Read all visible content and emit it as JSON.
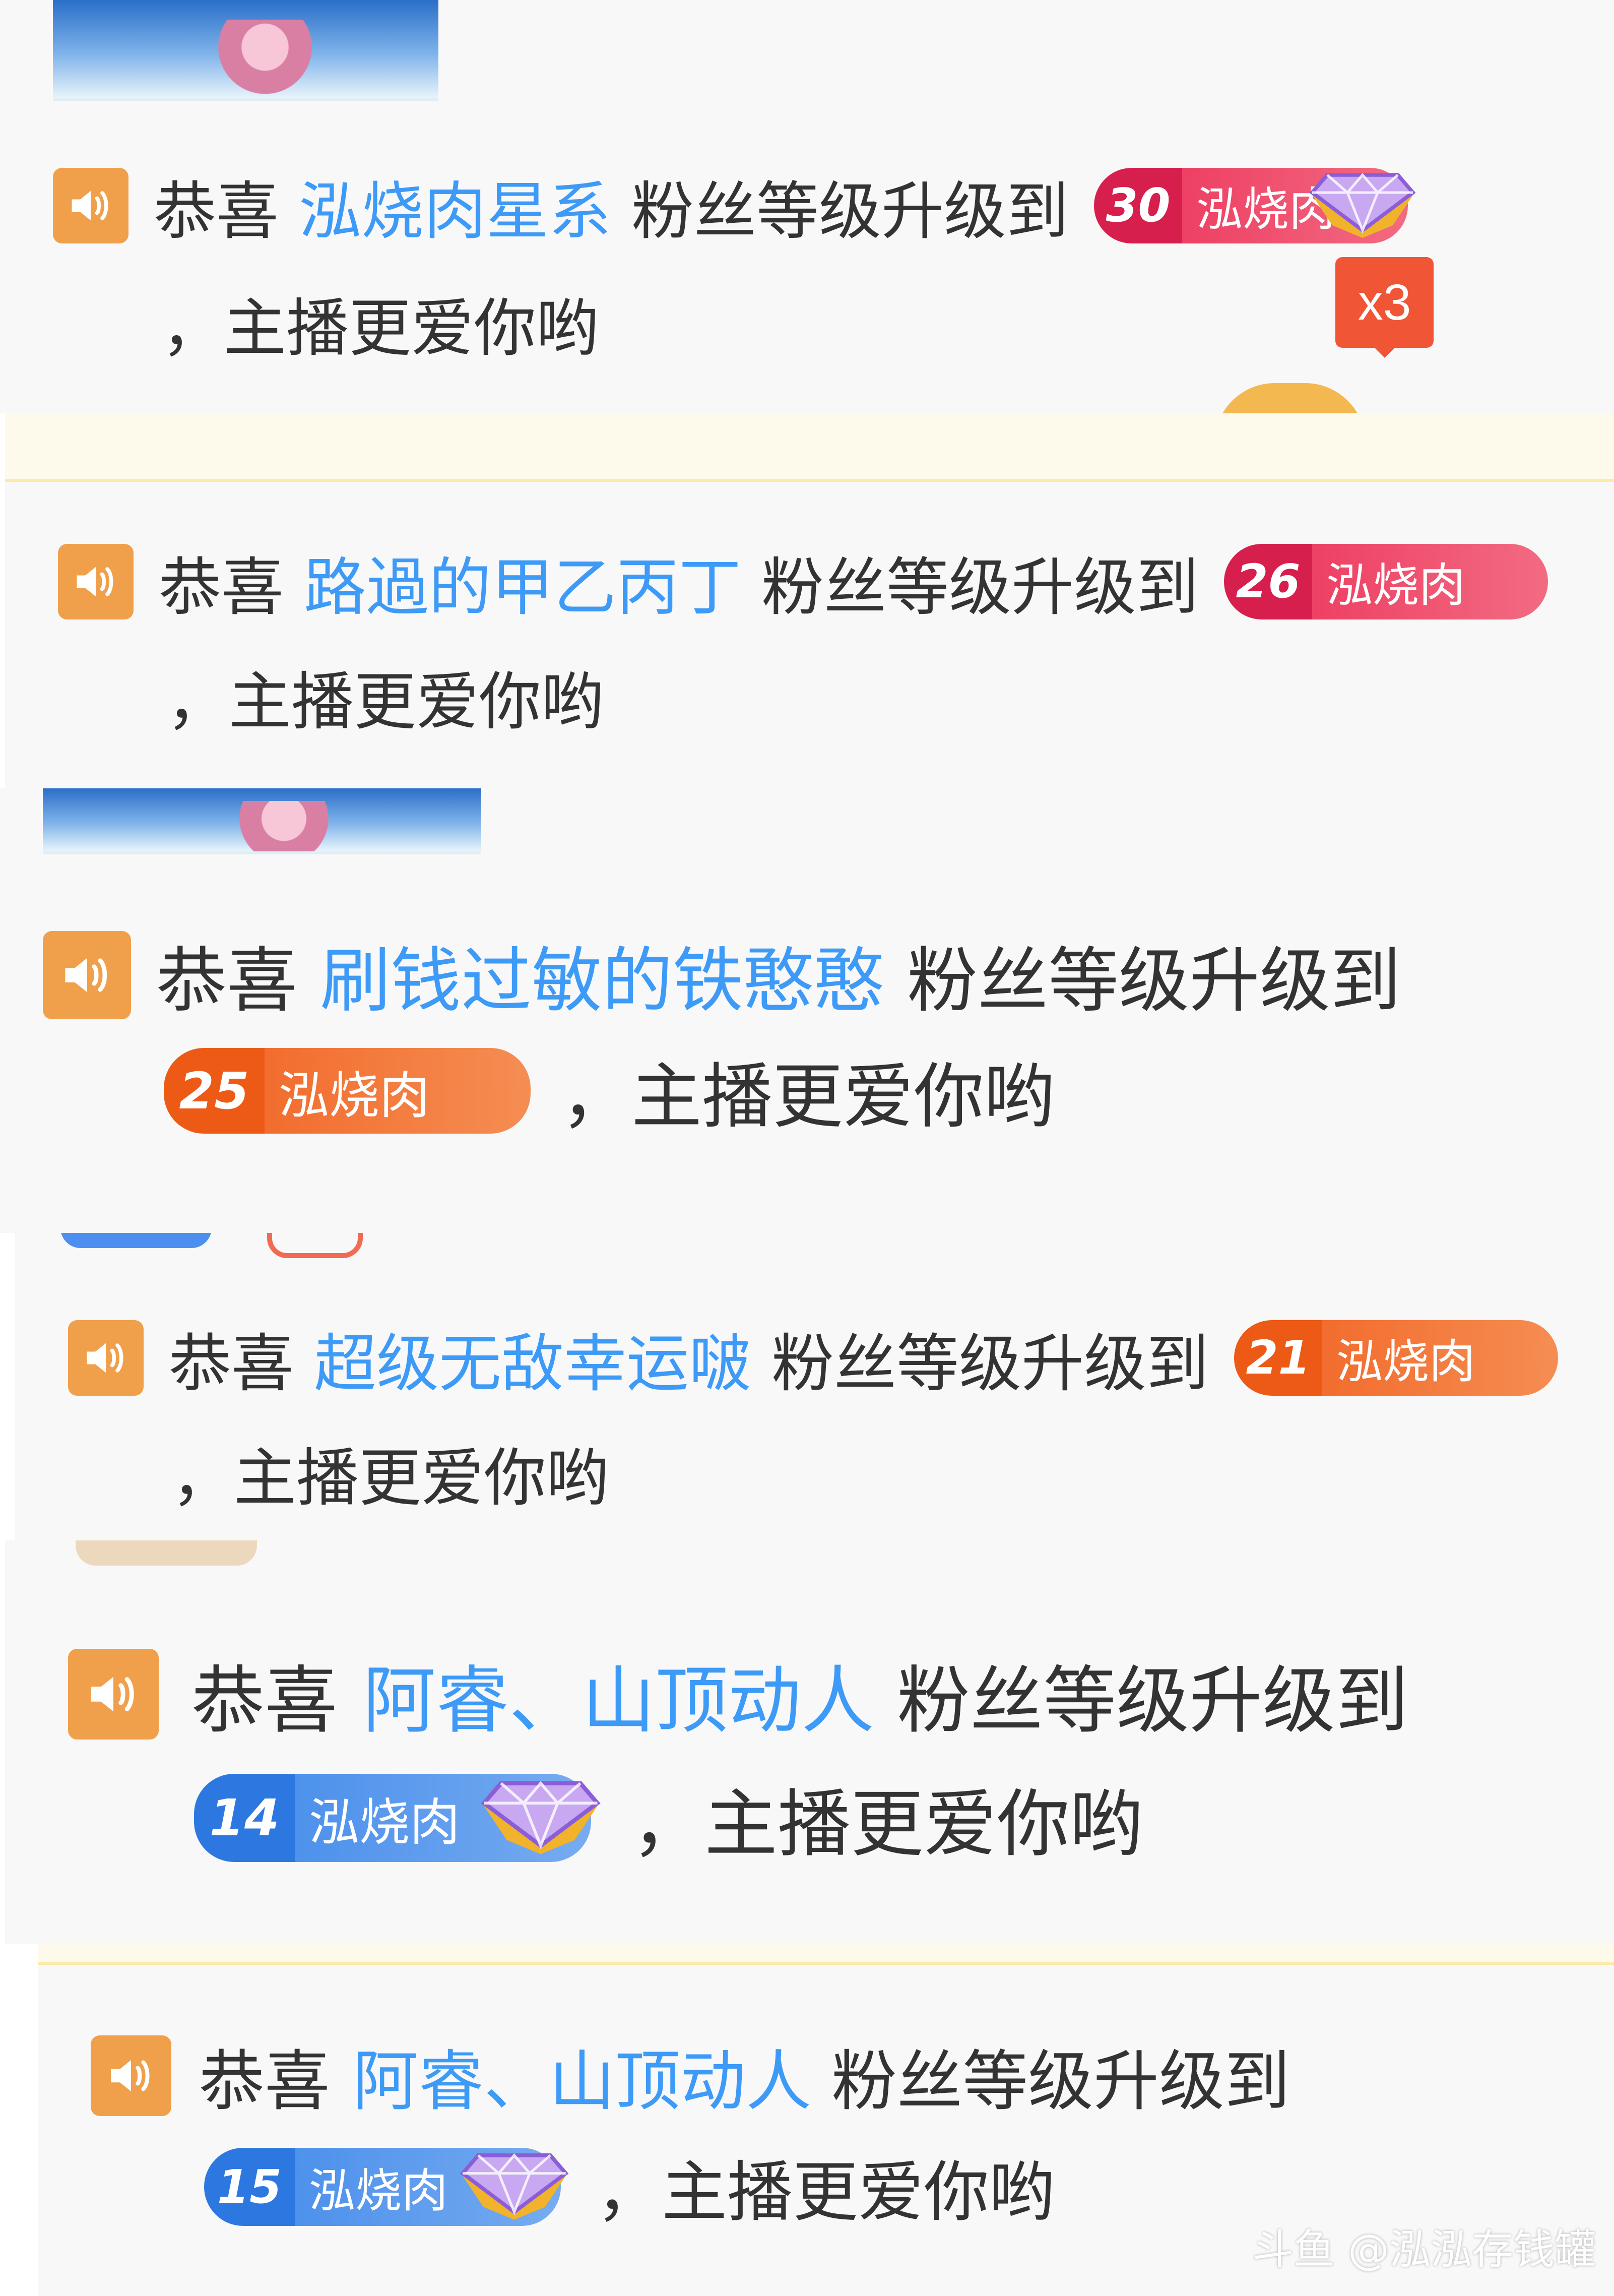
{
  "greeting": "恭喜",
  "upgrade_text": "粉丝等级升级到",
  "suffix_comma": "，",
  "suffix_text": "主播更爱你哟",
  "club_name": "泓烧肉",
  "colors": {
    "nickname": "#3d9af6",
    "speaker_icon_bg": "#f0a04a",
    "badge_red": "#e8345a",
    "badge_orange": "#f0652a",
    "badge_blue": "#3f86e6",
    "gift_bubble": "#f05536"
  },
  "messages": [
    {
      "nickname": "泓烧肉星系",
      "level": "30",
      "badge_color": "red",
      "gem": true
    },
    {
      "nickname": "路過的甲乙丙丁",
      "level": "26",
      "badge_color": "red",
      "gem": false
    },
    {
      "nickname": "刷钱过敏的铁憨憨",
      "level": "25",
      "badge_color": "orange",
      "gem": false
    },
    {
      "nickname": "超级无敌幸运啵",
      "level": "21",
      "badge_color": "orange",
      "gem": false
    },
    {
      "nickname": "阿睿、山顶动人",
      "level": "14",
      "badge_color": "blue",
      "gem": true
    },
    {
      "nickname": "阿睿、山顶动人",
      "level": "15",
      "badge_color": "blue",
      "gem": true
    }
  ],
  "gift_combo": "x3",
  "watermark": "斗鱼 @泓泓存钱罐",
  "icons": {
    "speaker": "speaker-volume-icon",
    "gem": "diamond-gem-icon"
  }
}
